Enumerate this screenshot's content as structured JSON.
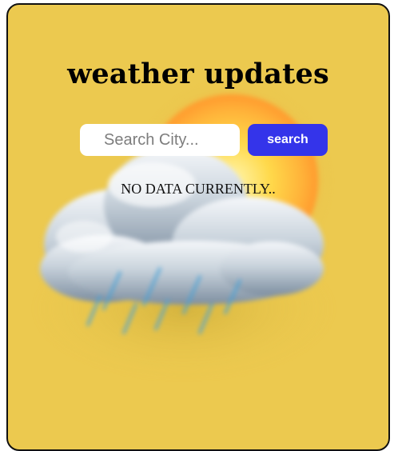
{
  "app": {
    "title": "weather updates"
  },
  "search": {
    "placeholder": "Search City...",
    "value": "",
    "button_label": "search"
  },
  "status": {
    "message": "NO DATA CURRENTLY.."
  },
  "background": {
    "icon": "cloud-sun-rain-icon"
  },
  "colors": {
    "card_background": "#ecc94f",
    "button": "#3434ea",
    "border": "#111111"
  }
}
